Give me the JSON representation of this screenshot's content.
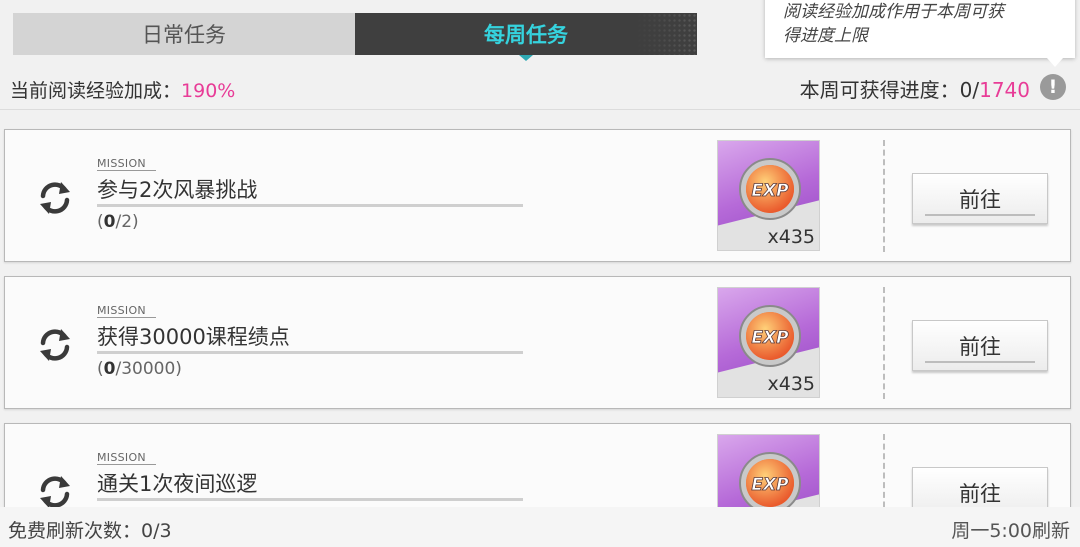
{
  "tabs": [
    {
      "label": "日常任务",
      "active": false
    },
    {
      "label": "每周任务",
      "active": true
    }
  ],
  "tooltip": {
    "line1": "阅读经验加成作用于本周可获",
    "line2": "得进度上限"
  },
  "header": {
    "bonus_label": "当前阅读经验加成：",
    "bonus_value": "190%",
    "progress_label": "本周可获得进度：",
    "progress_current": "0",
    "progress_sep": "/",
    "progress_max": "1740",
    "help_glyph": "!"
  },
  "missions": [
    {
      "tag": "MISSION",
      "title": "参与2次风暴挑战",
      "progress_open": "(",
      "progress_current": "0",
      "progress_total": "/2)",
      "reward_label": "EXP",
      "reward_qty": "x435",
      "button": "前往"
    },
    {
      "tag": "MISSION",
      "title": "获得30000课程绩点",
      "progress_open": "(",
      "progress_current": "0",
      "progress_total": "/30000)",
      "reward_label": "EXP",
      "reward_qty": "x435",
      "button": "前往"
    },
    {
      "tag": "MISSION",
      "title": "通关1次夜间巡逻",
      "progress_open": "",
      "progress_current": "",
      "progress_total": "",
      "reward_label": "EXP",
      "reward_qty": "",
      "button": "前往"
    }
  ],
  "footer": {
    "free_refresh": "免费刷新次数：0/3",
    "reset_time": "周一5:00刷新"
  },
  "colors": {
    "accent_cyan": "#35d3de",
    "accent_pink": "#e83c97",
    "reward_purple": "#b66ad8"
  },
  "icons": [
    "refresh-icon",
    "exp-coin-icon",
    "help-icon"
  ]
}
